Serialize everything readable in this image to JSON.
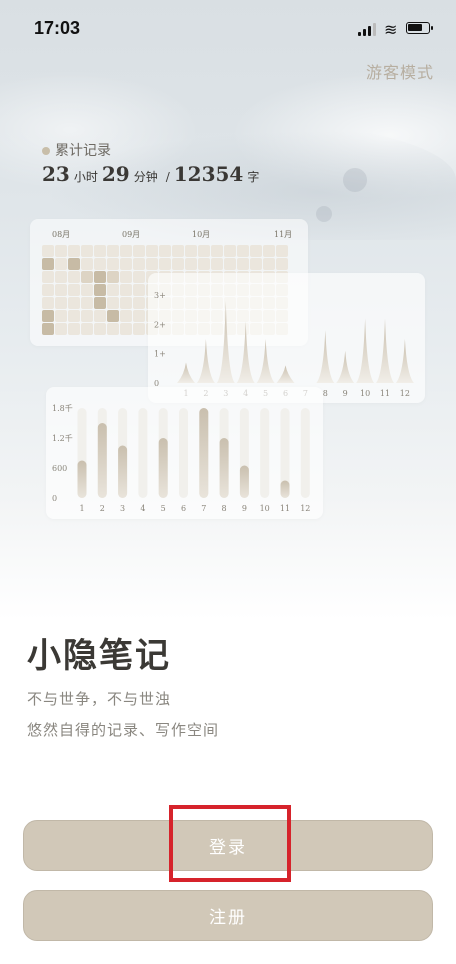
{
  "status_bar": {
    "time": "17:03",
    "signal_bars": 3,
    "battery_level_percent": 75
  },
  "header": {
    "guest_mode_label": "游客模式"
  },
  "stats": {
    "label": "累计记录",
    "hours": "23",
    "hours_unit": "小时",
    "minutes": "29",
    "minutes_unit": "分钟",
    "separator": "/",
    "words": "12354",
    "words_unit": "字"
  },
  "colors": {
    "accent": "#d1c8b8",
    "heat_dark": "#c7bba5",
    "heat_mid": "#ddd4c4",
    "heat_light": "#ebe6dd",
    "highlight": "#d6232b"
  },
  "chart_data": [
    {
      "type": "heatmap",
      "months": [
        "08月",
        "09月",
        "10月",
        "11月"
      ],
      "rows": 7,
      "columns": 19,
      "levels": [
        [
          0,
          0,
          0,
          0,
          0,
          0,
          0,
          0,
          0,
          0,
          0,
          0,
          0,
          0,
          0,
          0,
          0,
          0,
          0
        ],
        [
          2,
          0,
          2,
          0,
          0,
          0,
          0,
          0,
          0,
          0,
          0,
          0,
          0,
          0,
          0,
          0,
          0,
          0,
          0
        ],
        [
          0,
          0,
          0,
          1,
          2,
          1,
          0,
          0,
          0,
          0,
          0,
          0,
          0,
          0,
          0,
          0,
          0,
          0,
          0
        ],
        [
          0,
          0,
          0,
          0,
          2,
          0,
          0,
          0,
          0,
          0,
          0,
          0,
          0,
          0,
          0,
          0,
          0,
          0,
          0
        ],
        [
          0,
          0,
          0,
          0,
          2,
          0,
          0,
          0,
          0,
          0,
          0,
          0,
          0,
          0,
          0,
          0,
          0,
          0,
          0
        ],
        [
          2,
          0,
          0,
          0,
          0,
          2,
          0,
          0,
          0,
          0,
          0,
          0,
          0,
          0,
          0,
          0,
          0,
          0,
          0
        ],
        [
          2,
          0,
          0,
          0,
          0,
          0,
          0,
          0,
          0,
          0,
          0,
          0,
          0,
          0,
          0,
          0,
          0,
          0,
          0
        ]
      ]
    },
    {
      "type": "area",
      "categories": [
        "1",
        "2",
        "3",
        "4",
        "5",
        "6",
        "7",
        "8",
        "9",
        "10",
        "11",
        "12"
      ],
      "values": [
        0.7,
        1.5,
        2.8,
        2.1,
        1.5,
        0.6,
        0,
        1.8,
        1.1,
        2.2,
        2.2,
        1.5
      ],
      "ytick_labels": [
        "0",
        "1+",
        "2+",
        "3+"
      ],
      "ylim": [
        0,
        3
      ]
    },
    {
      "type": "bar",
      "categories": [
        "1",
        "2",
        "3",
        "4",
        "5",
        "6",
        "7",
        "8",
        "9",
        "10",
        "11",
        "12"
      ],
      "values": [
        750,
        1500,
        1050,
        0,
        1200,
        0,
        1800,
        1200,
        650,
        0,
        350,
        0
      ],
      "ytick_labels": [
        "0",
        "600",
        "1.2千",
        "1.8千"
      ],
      "ylim": [
        0,
        1800
      ]
    }
  ],
  "app": {
    "name": "小隐笔记",
    "slogan_line1": "不与世争，不与世浊",
    "slogan_line2": "悠然自得的记录、写作空间"
  },
  "buttons": {
    "login_label": "登录",
    "register_label": "注册"
  }
}
